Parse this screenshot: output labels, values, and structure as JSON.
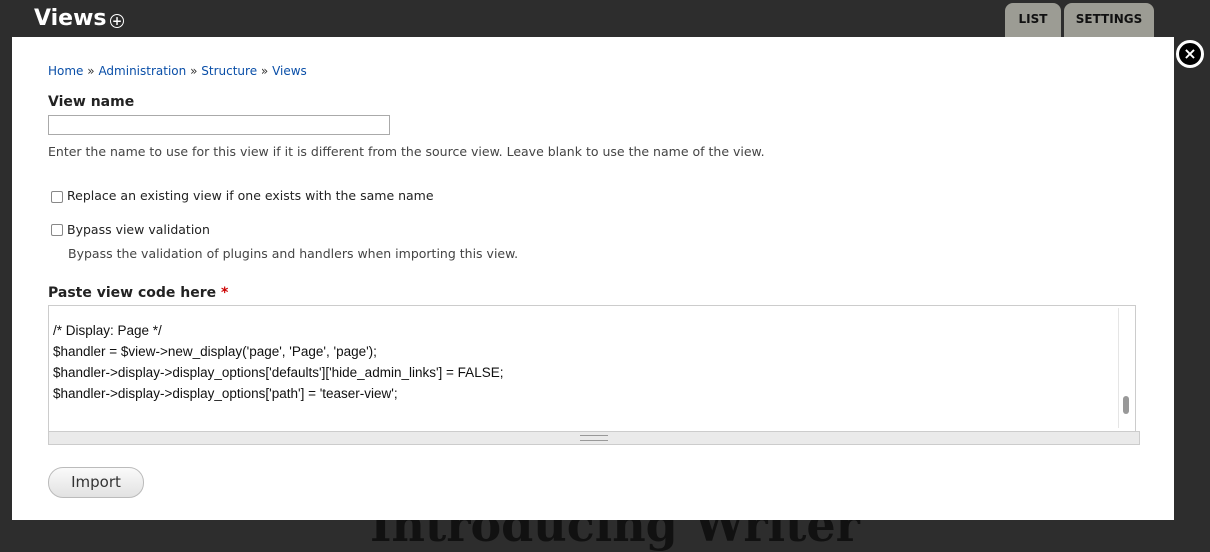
{
  "header": {
    "title": "Views",
    "add_icon": "plus-circle-icon",
    "tabs": [
      {
        "label": "LIST"
      },
      {
        "label": "SETTINGS"
      }
    ]
  },
  "background_text": "Introducing Writer",
  "breadcrumb": [
    {
      "label": "Home"
    },
    {
      "label": "Administration"
    },
    {
      "label": "Structure"
    },
    {
      "label": "Views"
    }
  ],
  "breadcrumb_sep": "»",
  "form": {
    "view_name_label": "View name",
    "view_name_value": "",
    "view_name_desc": "Enter the name to use for this view if it is different from the source view. Leave blank to use the name of the view.",
    "replace_label": "Replace an existing view if one exists with the same name",
    "replace_checked": false,
    "bypass_label": "Bypass view validation",
    "bypass_checked": false,
    "bypass_desc": "Bypass the validation of plugins and handlers when importing this view.",
    "code_label": "Paste view code here",
    "required_mark": "*",
    "code_lines": [
      "/* Display: Page */",
      "$handler = $view->new_display('page', 'Page', 'page');",
      "$handler->display->display_options['defaults']['hide_admin_links'] = FALSE;",
      "$handler->display->display_options['path'] = 'teaser-view';"
    ],
    "import_label": "Import"
  },
  "colors": {
    "link": "#0a4fa8",
    "required": "#c00",
    "background": "#2d2d2d"
  }
}
